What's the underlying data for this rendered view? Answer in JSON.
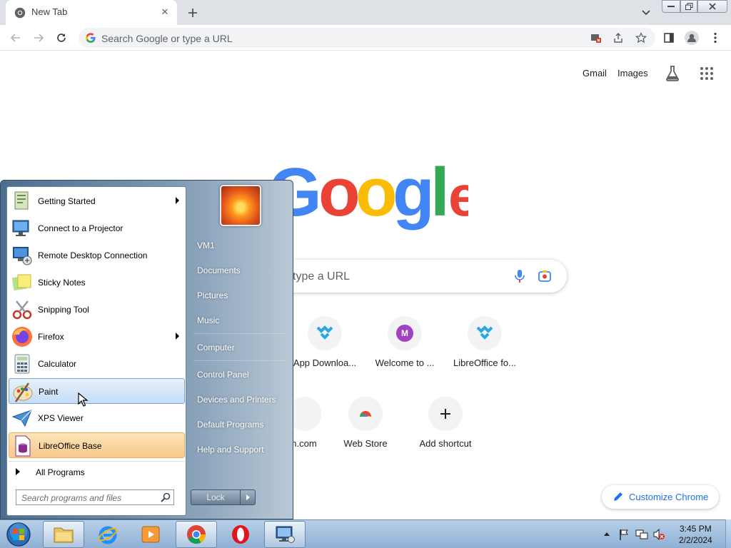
{
  "browser": {
    "tab_title": "New Tab",
    "omnibox_placeholder": "Search Google or type a URL"
  },
  "ntp": {
    "links": {
      "gmail": "Gmail",
      "images": "Images"
    },
    "search_placeholder": "type a URL",
    "shortcuts_row1": [
      "App Downloa...",
      "Welcome to ...",
      "LibreOffice fo..."
    ],
    "shortcuts_row2": [
      "n.com",
      "Web Store",
      "Add shortcut"
    ],
    "welcome_letter": "M",
    "customize": "Customize Chrome"
  },
  "start_menu": {
    "programs": [
      {
        "label": "Getting Started",
        "icon": "getting-started-icon",
        "submenu": true
      },
      {
        "label": "Connect to a Projector",
        "icon": "projector-icon",
        "submenu": false
      },
      {
        "label": "Remote Desktop Connection",
        "icon": "remote-desktop-icon",
        "submenu": false
      },
      {
        "label": "Sticky Notes",
        "icon": "sticky-notes-icon",
        "submenu": false
      },
      {
        "label": "Snipping Tool",
        "icon": "snipping-tool-icon",
        "submenu": false
      },
      {
        "label": "Firefox",
        "icon": "firefox-icon",
        "submenu": true
      },
      {
        "label": "Calculator",
        "icon": "calculator-icon",
        "submenu": false
      },
      {
        "label": "Paint",
        "icon": "paint-icon",
        "submenu": false
      },
      {
        "label": "XPS Viewer",
        "icon": "xps-viewer-icon",
        "submenu": false
      },
      {
        "label": "LibreOffice Base",
        "icon": "libreoffice-base-icon",
        "submenu": false
      }
    ],
    "all_programs": "All Programs",
    "search_placeholder": "Search programs and files",
    "right_links": [
      "VM1",
      "Documents",
      "Pictures",
      "Music",
      "Computer",
      "Control Panel",
      "Devices and Printers",
      "Default Programs",
      "Help and Support"
    ],
    "lock_label": "Lock"
  },
  "taskbar": {
    "apps": [
      "explorer",
      "internet-explorer",
      "media-player",
      "chrome",
      "opera",
      "remote-desktop"
    ],
    "time": "3:45 PM",
    "date": "2/2/2024"
  },
  "colors": {
    "google_blue": "#4285f4",
    "google_red": "#ea4335",
    "google_yellow": "#fbbc05",
    "google_green": "#34a853",
    "link_blue": "#1a73e8",
    "welcome_avatar": "#a142c1"
  }
}
